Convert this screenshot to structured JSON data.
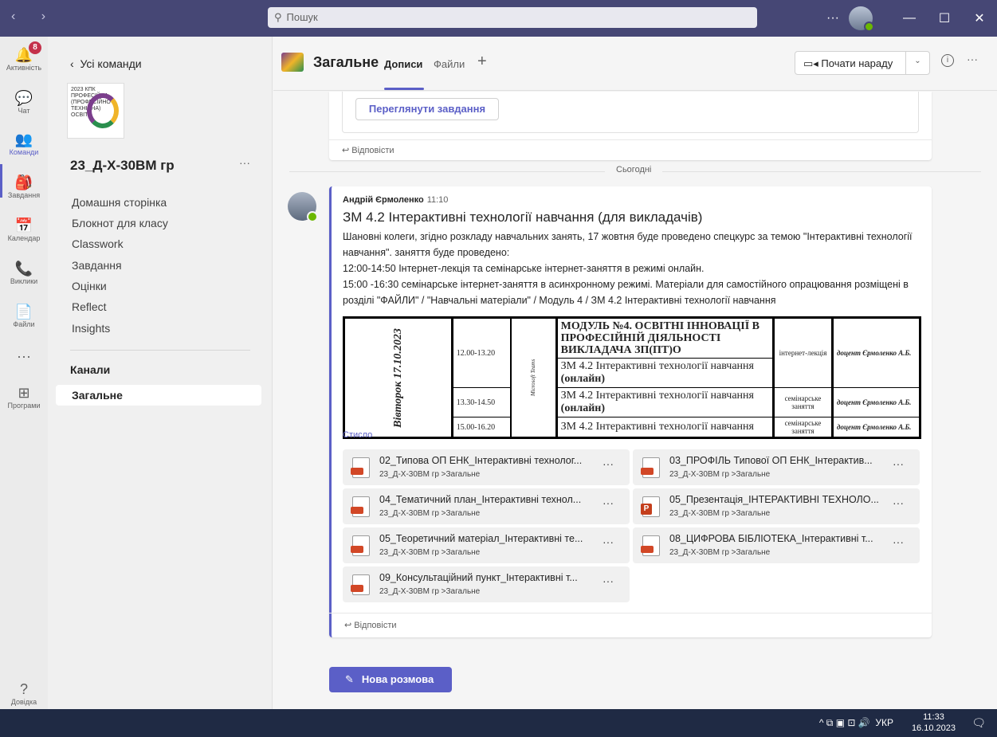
{
  "titlebar": {
    "nav_arrows": "‹ ›",
    "search_placeholder": "Пошук",
    "more": "···",
    "min": "—",
    "max": "☐",
    "close": "✕"
  },
  "rail": {
    "items": [
      {
        "label": "Активність",
        "icon": "bell-icon",
        "glyph": "🔔",
        "badge": "8"
      },
      {
        "label": "Чат",
        "icon": "chat-icon",
        "glyph": "💬"
      },
      {
        "label": "Команди",
        "icon": "teams-icon",
        "glyph": "👥"
      },
      {
        "label": "Завдання",
        "icon": "assignments-icon",
        "glyph": "🎒"
      },
      {
        "label": "Календар",
        "icon": "calendar-icon",
        "glyph": "📅"
      },
      {
        "label": "Виклики",
        "icon": "phone-icon",
        "glyph": "📞"
      },
      {
        "label": "Файли",
        "icon": "files-icon",
        "glyph": "📄"
      },
      {
        "label": "",
        "icon": "more-icon",
        "glyph": "···"
      },
      {
        "label": "Програми",
        "icon": "apps-icon",
        "glyph": "⊞"
      },
      {
        "label": "Довідка",
        "icon": "help-icon",
        "glyph": "?"
      }
    ],
    "active_color": "#5b5fc7"
  },
  "sidebar": {
    "back": "Усі команди",
    "logo_text": "2023 КПК ПРОФЕСІЙНА (ПРОФЕСІЙНО ТЕХНІЧНА) ОСВІТА",
    "team_name": "23_Д-Х-30ВМ гр",
    "team_more": "···",
    "links": [
      "Домашня сторінка",
      "Блокнот для класу",
      "Classwork",
      "Завдання",
      "Оцінки",
      "Reflect",
      "Insights"
    ],
    "channels_header": "Канали",
    "channel_active": "Загальне"
  },
  "header": {
    "channel_name": "Загальне",
    "tabs": [
      "Дописи",
      "Файли"
    ],
    "plus": "+",
    "meet_button": "Почати нараду",
    "info": "i",
    "more": "···"
  },
  "feed": {
    "view_tasks_button": "Переглянути завдання",
    "reply_label": "Відповісти",
    "date_separator": "Сьогодні",
    "post": {
      "author": "Андрій Єрмоленко",
      "time": "11:10",
      "title": "ЗМ 4.2 Інтерактивні технології навчання (для викладачів)",
      "body": [
        "Шановні колеги, згідно розкладу навчальних занять, 17 жовтня буде проведено спецкурс за темою \"Інтерактивні технології навчання\". заняття буде проведено:",
        "12:00-14:50 Інтернет-лекція та семінарське інтернет-заняття в режимі онлайн.",
        "15:00 -16:30 семінарське інтернет-заняття в асинхронному режимі. Матеріали для самостійного опрацювання розміщені в розділі \"ФАЙЛИ\" / \"Навчальні матеріали\" / Модуль 4 / ЗМ 4.2 Інтерактивні технології навчання"
      ],
      "schedule": {
        "day": "Вівторок 17.10.2023",
        "platform": "Microsoft Teams",
        "module_heading": "МОДУЛЬ №4. ОСВІТНІ ІННОВАЦІЇ В ПРОФЕСІЙНІЙ ДІЯЛЬНОСТІ ВИКЛАДАЧА ЗП(ПТ)О",
        "rows": [
          {
            "time": "12.00-13.20",
            "subject": "ЗМ 4.2 Інтерактивні технології навчання",
            "mode": "(онлайн)",
            "format": "інтернет-лекція",
            "lecturer": "доцент Єрмоленко А.Б."
          },
          {
            "time": "13.30-14.50",
            "subject": "ЗМ 4.2 Інтерактивні технології навчання",
            "mode": "(онлайн)",
            "format": "семінарське заняття",
            "lecturer": "доцент Єрмоленко А.Б."
          },
          {
            "time": "15.00-16.20",
            "subject": "ЗМ 4.2 Інтерактивні технології навчання",
            "mode": "",
            "format": "семінарське заняття",
            "lecturer": "доцент Єрмоленко А.Б."
          }
        ]
      },
      "collapse_label": "Стисло",
      "files": [
        {
          "name": "02_Типова ОП ЕНК_Інтерактивні технолог...",
          "path": "23_Д-Х-30ВМ гр >Загальне",
          "type": "pdf"
        },
        {
          "name": "03_ПРОФІЛЬ Типової ОП ЕНК_Інтерактив...",
          "path": "23_Д-Х-30ВМ гр >Загальне",
          "type": "pdf"
        },
        {
          "name": "04_Тематичний план_Інтерактивні технол...",
          "path": "23_Д-Х-30ВМ гр >Загальне",
          "type": "pdf"
        },
        {
          "name": "05_Презентація_ІНТЕРАКТИВНІ ТЕХНОЛО...",
          "path": "23_Д-Х-30ВМ гр >Загальне",
          "type": "pptx"
        },
        {
          "name": "05_Теоретичний матеріал_Інтерактивні те...",
          "path": "23_Д-Х-30ВМ гр >Загальне",
          "type": "pdf"
        },
        {
          "name": "08_ЦИФРОВА БІБЛІОТЕКА_Інтерактивні т...",
          "path": "23_Д-Х-30ВМ гр >Загальне",
          "type": "pdf"
        },
        {
          "name": "09_Консультаційний пункт_Інтерактивні т...",
          "path": "23_Д-Х-30ВМ гр >Загальне",
          "type": "pdf"
        }
      ],
      "file_more": "···"
    },
    "new_conversation": "Нова розмова"
  },
  "taskbar": {
    "tray_icons": "^ ⧉ ▣ ⊡ 🔊",
    "lang": "УКР",
    "time": "11:33",
    "date": "16.10.2023",
    "notification": "🗨"
  }
}
